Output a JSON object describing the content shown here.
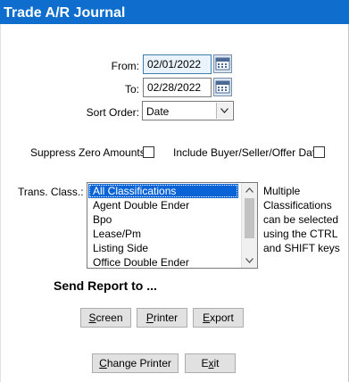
{
  "window": {
    "title": "Trade A/R Journal"
  },
  "form": {
    "from_label": "From:",
    "from_value": "02/01/2022",
    "to_label": "To:",
    "to_value": "02/28/2022",
    "sort_label": "Sort Order:",
    "sort_value": "Date",
    "suppress_label": "Suppress Zero Amounts:",
    "include_label": "Include Buyer/Seller/Offer Date:",
    "trans_label": "Trans. Class.:",
    "trans_items": [
      {
        "label": "All Classifications",
        "selected": true
      },
      {
        "label": "Agent Double Ender",
        "selected": false
      },
      {
        "label": "Bpo",
        "selected": false
      },
      {
        "label": "Lease/Pm",
        "selected": false
      },
      {
        "label": "Listing Side",
        "selected": false
      },
      {
        "label": "Office Double Ender",
        "selected": false
      }
    ],
    "hint_lines": [
      "Multiple",
      "Classifications",
      "can be selected",
      "using the CTRL",
      "and SHIFT keys"
    ]
  },
  "send": {
    "heading": "Send Report to ...",
    "screen_first": "S",
    "screen_rest": "creen",
    "printer_first": "P",
    "printer_rest": "rinter",
    "export_first": "E",
    "export_rest": "xport"
  },
  "footer": {
    "change_first": "C",
    "change_rest": "hange Printer",
    "exit_pre": "E",
    "exit_u": "x",
    "exit_post": "it"
  },
  "colors": {
    "titlebar": "#0f6ecd",
    "selection": "#0a64d6"
  }
}
